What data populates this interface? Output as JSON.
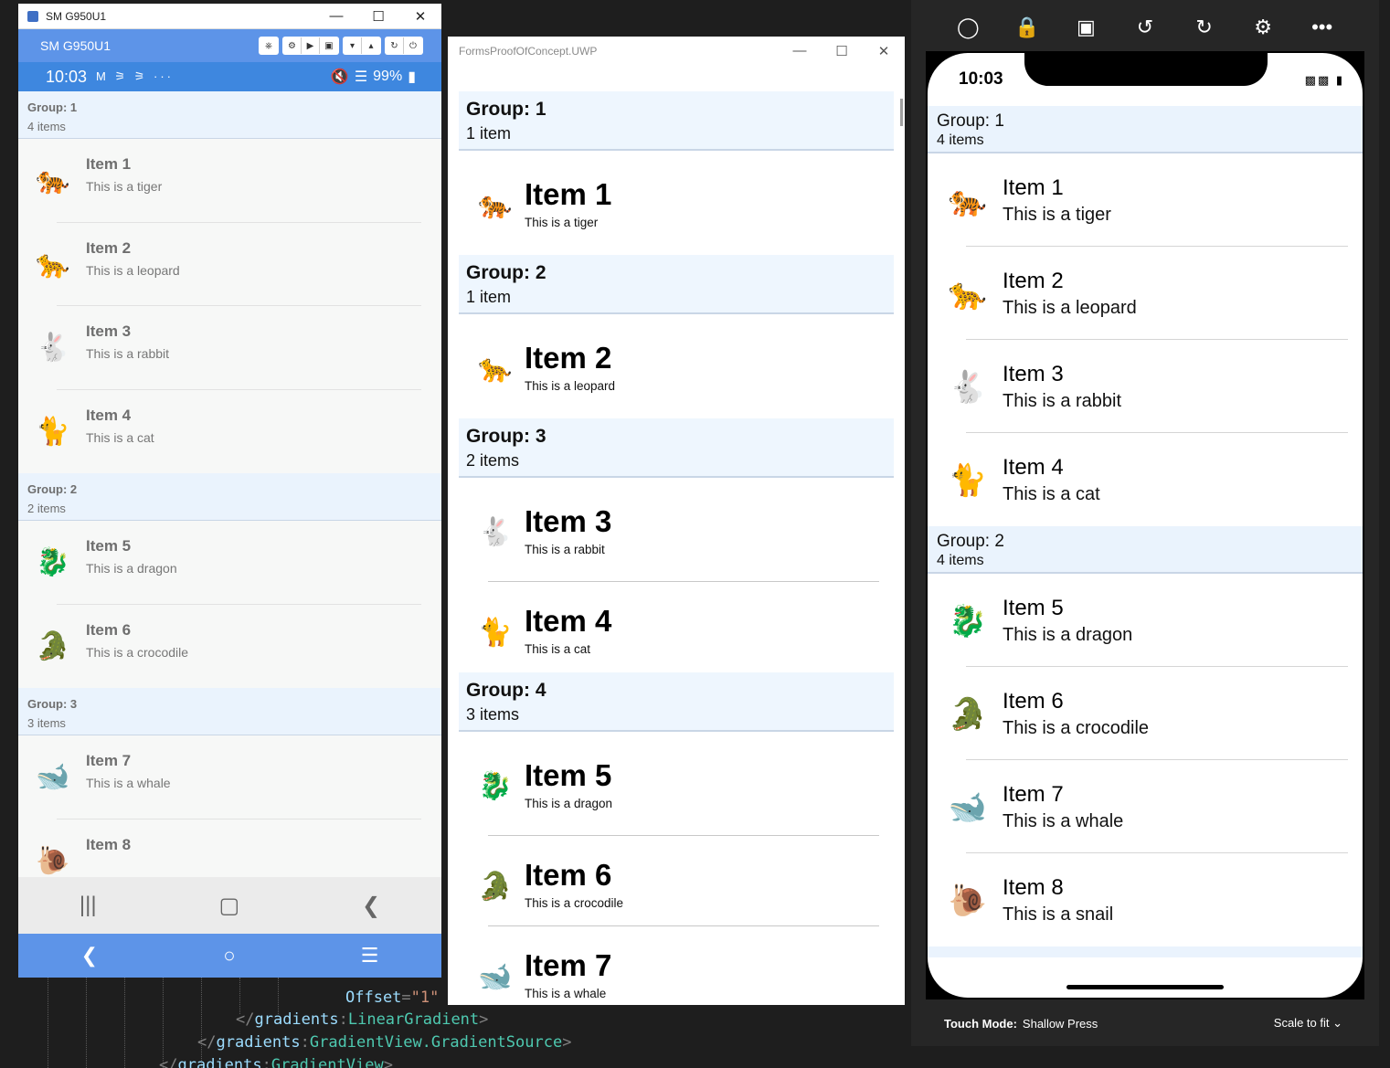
{
  "code": {
    "line1": {
      "attr": "Offset",
      "value": "\"1\""
    },
    "line2": {
      "ns": "gradients",
      "name": "LinearGradient"
    },
    "line3": {
      "ns": "gradients",
      "name": "GradientView.GradientSource"
    },
    "line4": {
      "ns": "gradients",
      "name": "GradientView"
    }
  },
  "android": {
    "window_title": "SM G950U1",
    "device_name": "SM G950U1",
    "status": {
      "time": "10:03",
      "notifications": "M ⚞ ⚞ ···",
      "battery": "99%"
    },
    "groups": [
      {
        "title": "Group: 1",
        "subtitle": "4 items",
        "items": [
          {
            "icon": "tiger-icon",
            "glyph": "🐅",
            "title": "Item 1",
            "subtitle": "This is a tiger"
          },
          {
            "icon": "leopard-icon",
            "glyph": "🐆",
            "title": "Item 2",
            "subtitle": "This is a leopard"
          },
          {
            "icon": "rabbit-icon",
            "glyph": "🐇",
            "title": "Item 3",
            "subtitle": "This is a rabbit"
          },
          {
            "icon": "cat-icon",
            "glyph": "🐈",
            "title": "Item 4",
            "subtitle": "This is a cat"
          }
        ]
      },
      {
        "title": "Group: 2",
        "subtitle": "2 items",
        "items": [
          {
            "icon": "dragon-icon",
            "glyph": "🐉",
            "title": "Item 5",
            "subtitle": "This is a dragon"
          },
          {
            "icon": "crocodile-icon",
            "glyph": "🐊",
            "title": "Item 6",
            "subtitle": "This is a crocodile"
          }
        ]
      },
      {
        "title": "Group: 3",
        "subtitle": "3 items",
        "items": [
          {
            "icon": "whale-icon",
            "glyph": "🐋",
            "title": "Item 7",
            "subtitle": "This is a whale"
          },
          {
            "icon": "snail-icon",
            "glyph": "🐌",
            "title": "Item 8",
            "subtitle": ""
          }
        ]
      }
    ]
  },
  "uwp": {
    "window_title": "FormsProofOfConcept.UWP",
    "groups": [
      {
        "title": "Group: 1",
        "subtitle": "1 item",
        "items": [
          {
            "icon": "tiger-icon",
            "glyph": "🐅",
            "title": "Item 1",
            "subtitle": "This is a tiger"
          }
        ]
      },
      {
        "title": "Group: 2",
        "subtitle": "1 item",
        "items": [
          {
            "icon": "leopard-icon",
            "glyph": "🐆",
            "title": "Item 2",
            "subtitle": "This is a leopard"
          }
        ]
      },
      {
        "title": "Group: 3",
        "subtitle": "2 items",
        "items": [
          {
            "icon": "rabbit-icon",
            "glyph": "🐇",
            "title": "Item 3",
            "subtitle": "This is a rabbit"
          },
          {
            "icon": "cat-icon",
            "glyph": "🐈",
            "title": "Item 4",
            "subtitle": "This is a cat"
          }
        ]
      },
      {
        "title": "Group: 4",
        "subtitle": "3 items",
        "items": [
          {
            "icon": "dragon-icon",
            "glyph": "🐉",
            "title": "Item 5",
            "subtitle": "This is a dragon"
          },
          {
            "icon": "crocodile-icon",
            "glyph": "🐊",
            "title": "Item 6",
            "subtitle": "This is a crocodile"
          },
          {
            "icon": "whale-icon",
            "glyph": "🐋",
            "title": "Item 7",
            "subtitle": "This is a whale"
          }
        ]
      }
    ]
  },
  "ios": {
    "time": "10:03",
    "groups": [
      {
        "title": "Group: 1",
        "subtitle": "4 items",
        "items": [
          {
            "icon": "tiger-icon",
            "glyph": "🐅",
            "title": "Item 1",
            "subtitle": "This is a tiger"
          },
          {
            "icon": "leopard-icon",
            "glyph": "🐆",
            "title": "Item 2",
            "subtitle": "This is a leopard"
          },
          {
            "icon": "rabbit-icon",
            "glyph": "🐇",
            "title": "Item 3",
            "subtitle": "This is a rabbit"
          },
          {
            "icon": "cat-icon",
            "glyph": "🐈",
            "title": "Item 4",
            "subtitle": "This is a cat"
          }
        ]
      },
      {
        "title": "Group: 2",
        "subtitle": "4 items",
        "items": [
          {
            "icon": "dragon-icon",
            "glyph": "🐉",
            "title": "Item 5",
            "subtitle": "This is a dragon"
          },
          {
            "icon": "crocodile-icon",
            "glyph": "🐊",
            "title": "Item 6",
            "subtitle": "This is a crocodile"
          },
          {
            "icon": "whale-icon",
            "glyph": "🐋",
            "title": "Item 7",
            "subtitle": "This is a whale"
          },
          {
            "icon": "snail-icon",
            "glyph": "🐌",
            "title": "Item 8",
            "subtitle": "This is a snail"
          }
        ]
      }
    ],
    "footer": {
      "touch_label": "Touch Mode:",
      "touch_value": "Shallow Press",
      "scale": "Scale to fit"
    }
  }
}
